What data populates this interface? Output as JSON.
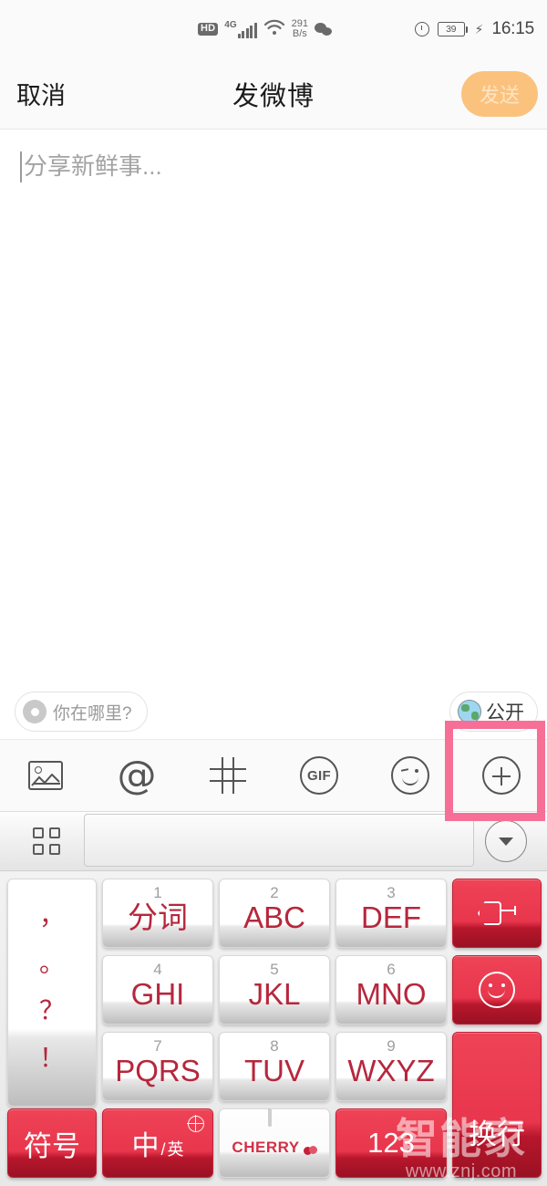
{
  "status_bar": {
    "hd_badge": "HD",
    "network_type": "4G",
    "net_speed_value": "291",
    "net_speed_unit": "B/s",
    "wechat_icon": "wechat-icon",
    "alarm_icon": "alarm-clock-icon",
    "battery_level": "39",
    "charging_icon": "lightning-bolt-icon",
    "time": "16:15"
  },
  "nav_bar": {
    "cancel_label": "取消",
    "title": "发微博",
    "send_label": "发送",
    "send_bg": "#fbc27e",
    "send_text_color": "#fde4c2"
  },
  "compose": {
    "placeholder": "分享新鲜事..."
  },
  "meta_row": {
    "location_label": "你在哪里?",
    "location_icon": "location-pin-icon",
    "privacy_label": "公开",
    "privacy_icon": "globe-icon"
  },
  "toolbar": {
    "items": [
      {
        "name": "image-icon",
        "label": ""
      },
      {
        "name": "at-mention-icon",
        "label": "@"
      },
      {
        "name": "hashtag-icon",
        "label": ""
      },
      {
        "name": "gif-icon",
        "label": "GIF"
      },
      {
        "name": "emoji-icon",
        "label": ""
      },
      {
        "name": "plus-icon",
        "label": ""
      }
    ],
    "highlight_color": "#f76f96"
  },
  "keyboard": {
    "candidate_bar": {
      "grid_icon": "grid-menu-icon",
      "candidate_text": "",
      "collapse_icon": "chevron-down-icon"
    },
    "punctuation_key": {
      "name": "punctuation-key",
      "chars": [
        "，",
        "。",
        "？",
        "！"
      ]
    },
    "number_keys": [
      {
        "num": "1",
        "label": "分词"
      },
      {
        "num": "2",
        "label": "ABC"
      },
      {
        "num": "3",
        "label": "DEF"
      },
      {
        "num": "4",
        "label": "GHI"
      },
      {
        "num": "5",
        "label": "JKL"
      },
      {
        "num": "6",
        "label": "MNO"
      },
      {
        "num": "7",
        "label": "PQRS"
      },
      {
        "num": "8",
        "label": "TUV"
      },
      {
        "num": "9",
        "label": "WXYZ"
      }
    ],
    "function_keys": {
      "backspace": "backspace-icon",
      "emoji": "emoji-smiley-icon",
      "enter_label": "换行",
      "symbols_label": "符号",
      "lang_main": "中",
      "lang_sep": "/",
      "lang_secondary": "英",
      "lang_globe": "globe-icon",
      "space_mic_icon": "microphone-icon",
      "space_brand": "CHERRY",
      "numeric_label": "123"
    },
    "key_red": "#e8364d",
    "key_text_red": "#b6273c"
  },
  "watermark": {
    "line1": "智能家",
    "line2": "www.znj.com"
  }
}
